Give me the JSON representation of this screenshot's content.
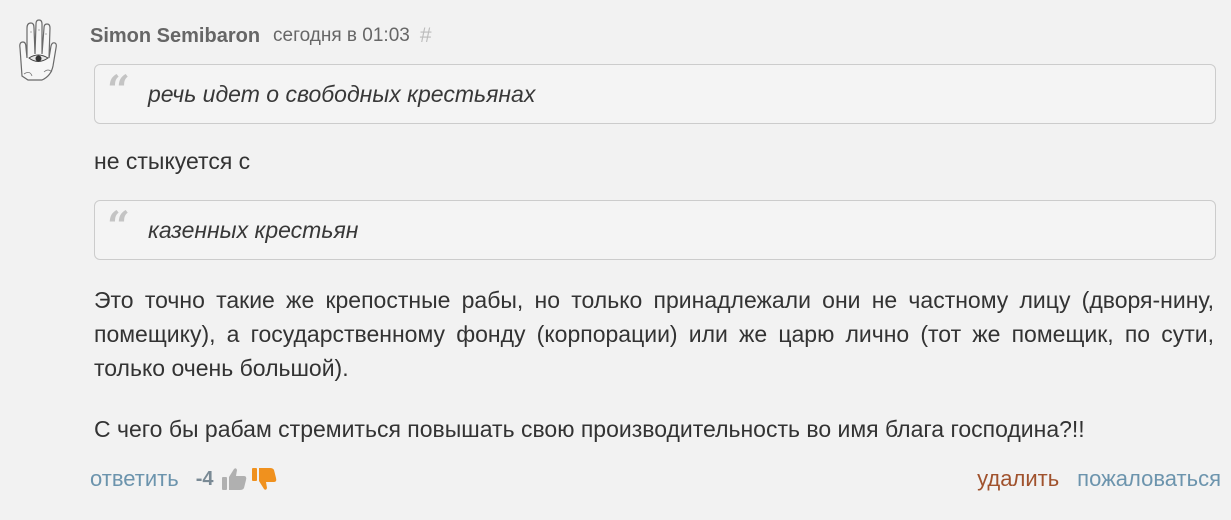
{
  "comment": {
    "author": "Simon Semibaron",
    "timestamp": "сегодня в 01:03",
    "permalink_symbol": "#",
    "quote1": "речь идет о свободных крестьянах",
    "text1": "не стыкуется с",
    "quote2": "казенных крестьян",
    "text2": "Это точно такие же крепостные рабы, но только принадлежали они не частному лицу (дворя-нину, помещику), а государственному фонду (корпорации) или же царю лично (тот же помещик, по сути, только очень большой).",
    "text3": "С чего бы рабам стремиться повышать свою производительность во имя блага господина?!!"
  },
  "actions": {
    "reply": "ответить",
    "rating": "-4",
    "delete": "удалить",
    "report": "пожаловаться"
  },
  "icons": {
    "quote": "quote-mark-icon",
    "upvote": "thumbs-up-icon",
    "downvote": "thumbs-down-icon"
  },
  "colors": {
    "link": "#6c94ad",
    "delete": "#a0522d",
    "downvote_active": "#f0911e",
    "upvote_inactive": "#b0b0b0"
  }
}
